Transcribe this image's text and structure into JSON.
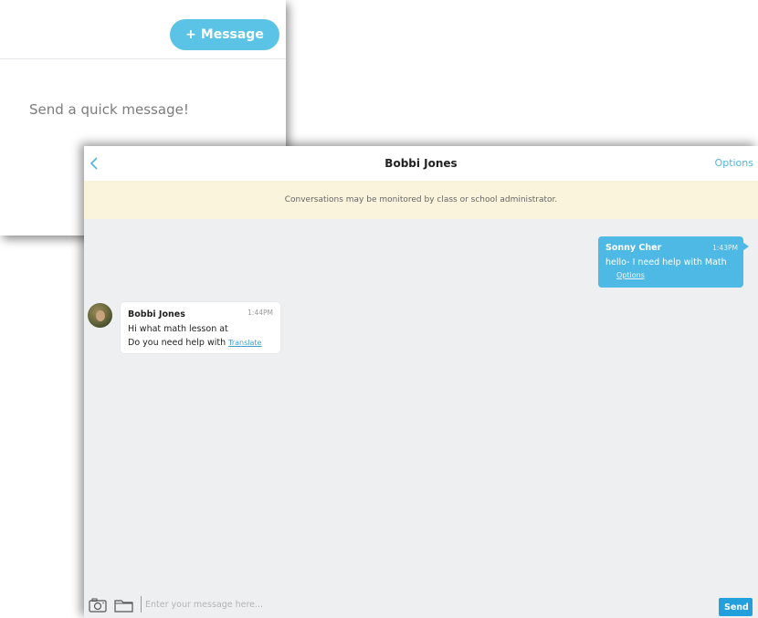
{
  "back_panel": {
    "new_message_label": "+ Message",
    "empty_state_text": "Send a quick message!"
  },
  "chat": {
    "title": "Bobbi Jones",
    "options_label": "Options",
    "notice": "Conversations may be monitored by class or school administrator.",
    "messages": [
      {
        "direction": "outgoing",
        "sender": "Sonny Cher",
        "time": "1:43PM",
        "text": "hello- I need help with Math",
        "action_label": "Options"
      },
      {
        "direction": "incoming",
        "sender": "Bobbi Jones",
        "time": "1:44PM",
        "line1": "Hi what math lesson at",
        "line2": "Do you need help with",
        "action_label": "Translate"
      }
    ]
  },
  "composer": {
    "placeholder": "Enter your message here...",
    "send_label": "Send"
  },
  "colors": {
    "accent": "#4fb9e6",
    "send_button": "#23a0dc",
    "notice_bg": "#faf4dc",
    "chat_bg": "#eeeff1"
  },
  "icons": [
    "chevron-left-icon",
    "camera-icon",
    "folder-icon"
  ]
}
